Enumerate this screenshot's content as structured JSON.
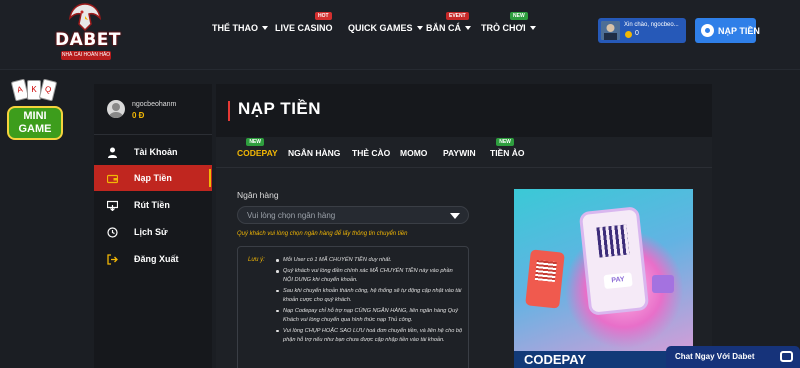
{
  "brand": {
    "name": "DABET",
    "tagline": "NHÀ CÁI HOÀN HẢO"
  },
  "nav": [
    {
      "label": "THỂ THAO",
      "caret": true,
      "badge": ""
    },
    {
      "label": "LIVE CASINO",
      "caret": false,
      "badge": "HOT"
    },
    {
      "label": "QUICK GAMES",
      "caret": true,
      "badge": ""
    },
    {
      "label": "BẮN CÁ",
      "caret": true,
      "badge": "EVENT"
    },
    {
      "label": "TRÒ CHƠI",
      "caret": true,
      "badge": "NEW"
    }
  ],
  "header_user": {
    "greeting": "Xin chào, ngocbeo...",
    "balance": "0"
  },
  "deposit_button": "NẠP TIỀN",
  "minigame": {
    "label": "MINI GAME",
    "cards": [
      "A",
      "K",
      "Q"
    ]
  },
  "sidebar": {
    "username": "ngocbeohanm",
    "balance": "0 Đ",
    "items": [
      {
        "label": "Tài Khoản",
        "icon": "user-icon",
        "active": false
      },
      {
        "label": "Nạp Tiền",
        "icon": "wallet-icon",
        "active": true
      },
      {
        "label": "Rút Tiền",
        "icon": "withdraw-icon",
        "active": false
      },
      {
        "label": "Lịch Sử",
        "icon": "history-icon",
        "active": false
      },
      {
        "label": "Đăng Xuất",
        "icon": "logout-icon",
        "active": false
      }
    ]
  },
  "page": {
    "title": "NẠP TIỀN",
    "tabs": [
      {
        "label": "CODEPAY",
        "new": "NEW",
        "active": true
      },
      {
        "label": "NGÂN HÀNG",
        "new": "",
        "active": false
      },
      {
        "label": "THẺ CÀO",
        "new": "",
        "active": false
      },
      {
        "label": "MOMO",
        "new": "",
        "active": false
      },
      {
        "label": "PAYWIN",
        "new": "",
        "active": false
      },
      {
        "label": "TIỀN ẢO",
        "new": "NEW",
        "active": false
      }
    ],
    "bank_label": "Ngân hàng",
    "bank_placeholder": "Vui lòng chọn ngân hàng",
    "hint": "Quý khách vui lòng chọn ngân hàng để lấy thông tin chuyển tiền",
    "notes_heading": "Lưu ý:",
    "notes": [
      "Mỗi User có 1 MÃ CHUYỂN TIỀN duy nhất.",
      "Quý khách vui lòng điền chính xác MÃ CHUYỂN TIỀN này vào phần NỘI DUNG khi chuyển khoản.",
      "Sau khi chuyển khoản thành công, hệ thống sẽ tự động cập nhật vào tài khoản cược cho quý khách.",
      "Nạp Codepay chỉ hỗ trợ nạp CÙNG NGÂN HÀNG, liên ngân hàng Quý Khách vui lòng chuyển qua hình thức nạp Thủ công.",
      "Vui lòng CHỤP HOẶC SAO LƯU hoá đơn chuyển tiền, và liên hệ cho bộ phận hỗ trợ nếu như bạn chưa được cập nhập tiền vào tài khoản."
    ],
    "promo": {
      "pay_label": "PAY",
      "footer_text": "CODEPAY"
    }
  },
  "chat": {
    "label": "Chat Ngay Với Dabet"
  },
  "colors": {
    "accent_red": "#c0261f",
    "accent_gold": "#f2b705",
    "button_blue": "#2f7fe8",
    "badge_green": "#2e9e3e"
  }
}
